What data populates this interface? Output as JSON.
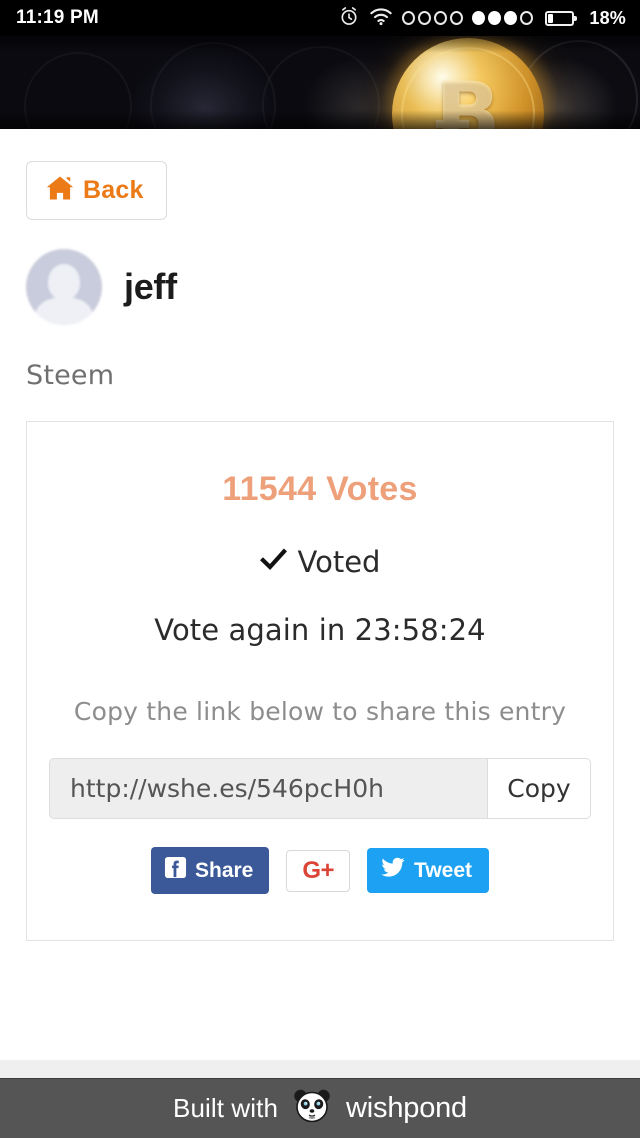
{
  "status_bar": {
    "time": "11:19 PM",
    "battery_percent": "18%",
    "battery_level": 18,
    "icons": [
      "alarm-clock-icon",
      "wifi-icon",
      "signal-sim1-icon",
      "signal-sim2-icon",
      "battery-icon"
    ],
    "signal_sim1": {
      "total": 4,
      "filled": 0
    },
    "signal_sim2": {
      "total": 4,
      "filled": 3
    },
    "background_color": "#000000",
    "text_color": "#ffffff"
  },
  "banner": {
    "alt": "cryptocurrency coins with glowing gold bitcoin",
    "bitcoin_glyph": "Ƀ"
  },
  "nav": {
    "back_label": "Back",
    "back_icon": "home-icon",
    "back_color": "#eb7a17"
  },
  "profile": {
    "name": "jeff",
    "avatar_icon": "default-user-avatar"
  },
  "entry": {
    "title": "Steem"
  },
  "card": {
    "vote_count_label": "11544 Votes",
    "vote_count": 11544,
    "vote_count_color": "#eda07a",
    "voted_label": "Voted",
    "voted_icon": "checkmark-icon",
    "vote_again_label": "Vote again in 23:58:24",
    "countdown": "23:58:24",
    "share_prompt": "Copy the link below to share this entry",
    "share_link": "http://wshe.es/546pcH0h",
    "share_link_placeholder": "http://wshe.es/546pcH0h",
    "copy_button_label": "Copy",
    "social": {
      "facebook": {
        "label": "Share",
        "icon": "facebook-icon",
        "color": "#3b5998"
      },
      "google_plus": {
        "label": "G+",
        "icon": "google-plus-icon",
        "color": "#db4437"
      },
      "twitter": {
        "label": "Tweet",
        "icon": "twitter-bird-icon",
        "color": "#1da1f2"
      }
    }
  },
  "footer": {
    "built_with": "Built with",
    "brand": "wishpond",
    "logo_icon": "panda-icon",
    "background_color": "#555555"
  }
}
